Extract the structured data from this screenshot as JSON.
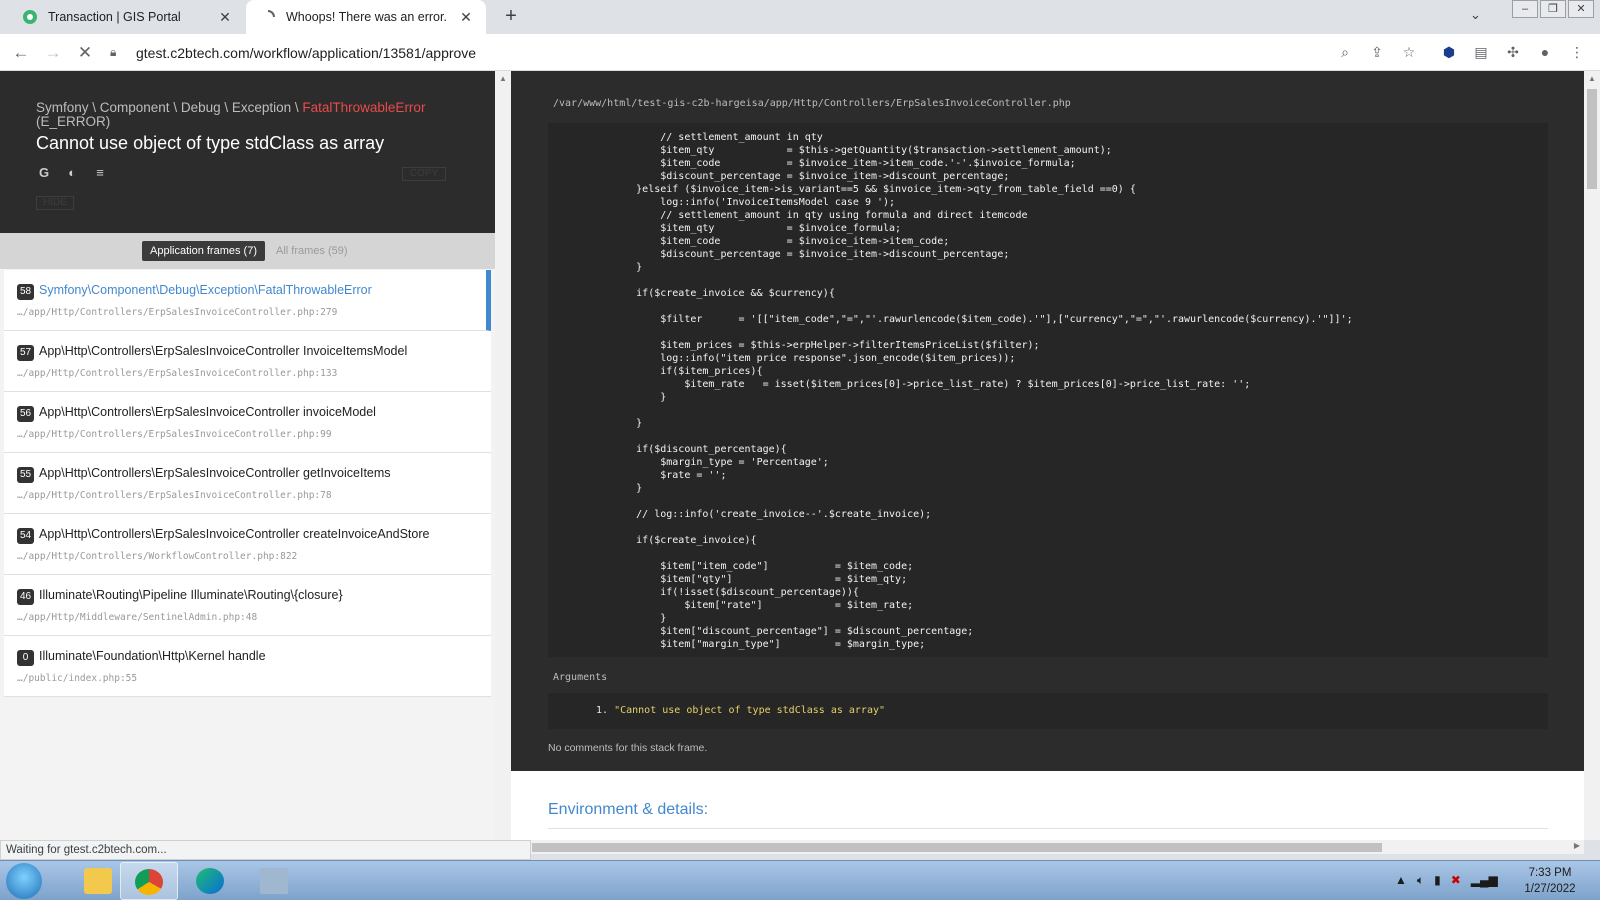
{
  "browser": {
    "tabs": [
      {
        "title": "Transaction | GIS Portal",
        "active": false
      },
      {
        "title": "Whoops! There was an error.",
        "active": true
      }
    ],
    "new_tab": "+",
    "url": "gtest.c2btech.com/workflow/application/13581/approve",
    "status_text": "Waiting for gtest.c2btech.com..."
  },
  "exception": {
    "class_path": "Symfony \\ Component \\ Debug \\ Exception \\ ",
    "class_name": "FatalThrowableError",
    "level": "(E_ERROR)",
    "message": "Cannot use object of type stdClass as array",
    "copy_label": "COPY",
    "hide_label": "HIDE"
  },
  "frame_tabs": {
    "application": "Application frames (7)",
    "all": "All frames (59)"
  },
  "frames": [
    {
      "index": "58",
      "class": "Symfony\\Component\\Debug\\Exception\\FatalThrowableError",
      "path": "…/app/Http/Controllers/ErpSalesInvoiceController.php:279"
    },
    {
      "index": "57",
      "class": "App\\Http\\Controllers\\ErpSalesInvoiceController InvoiceItemsModel",
      "path": "…/app/Http/Controllers/ErpSalesInvoiceController.php:133"
    },
    {
      "index": "56",
      "class": "App\\Http\\Controllers\\ErpSalesInvoiceController invoiceModel",
      "path": "…/app/Http/Controllers/ErpSalesInvoiceController.php:99"
    },
    {
      "index": "55",
      "class": "App\\Http\\Controllers\\ErpSalesInvoiceController getInvoiceItems",
      "path": "…/app/Http/Controllers/ErpSalesInvoiceController.php:78"
    },
    {
      "index": "54",
      "class": "App\\Http\\Controllers\\ErpSalesInvoiceController createInvoiceAndStore",
      "path": "…/app/Http/Controllers/WorkflowController.php:822"
    },
    {
      "index": "46",
      "class": "Illuminate\\Routing\\Pipeline Illuminate\\Routing\\{closure}",
      "path": "…/app/Http/Middleware/SentinelAdmin.php:48"
    },
    {
      "index": "0",
      "class": "Illuminate\\Foundation\\Http\\Kernel handle",
      "path": "…/public/index.php:55"
    }
  ],
  "code_view": {
    "file_path": "/var/www/html/test-gis-c2b-hargeisa/app/Http/Controllers/ErpSalesInvoiceController.php",
    "lines": [
      "            // settlement_amount in qty",
      "            $item_qty            = $this->getQuantity($transaction->settlement_amount);",
      "            $item_code           = $invoice_item->item_code.'-'.$invoice_formula;",
      "            $discount_percentage = $invoice_item->discount_percentage;",
      "        }elseif ($invoice_item->is_variant==5 && $invoice_item->qty_from_table_field ==0) {",
      "            log::info('InvoiceItemsModel case 9 ');",
      "            // settlement_amount in qty using formula and direct itemcode",
      "            $item_qty            = $invoice_formula;",
      "            $item_code           = $invoice_item->item_code;",
      "            $discount_percentage = $invoice_item->discount_percentage;",
      "        }",
      "",
      "        if($create_invoice && $currency){",
      "",
      "            $filter      = '[[\"item_code\",\"=\",\"'.rawurlencode($item_code).'\"],[\"currency\",\"=\",\"'.rawurlencode($currency).'\"]]';",
      "",
      "            $item_prices = $this->erpHelper->filterItemsPriceList($filter);",
      "            log::info(\"item price response\".json_encode($item_prices));",
      "            if($item_prices){",
      "                $item_rate   = isset($item_prices[0]->price_list_rate) ? $item_prices[0]->price_list_rate: '';",
      "            }",
      "",
      "        }",
      "",
      "        if($discount_percentage){",
      "            $margin_type = 'Percentage';",
      "            $rate = '';",
      "        }",
      "",
      "        // log::info('create_invoice--'.$create_invoice);",
      "",
      "        if($create_invoice){",
      "",
      "            $item[\"item_code\"]           = $item_code;",
      "            $item[\"qty\"]                 = $item_qty;",
      "            if(!isset($discount_percentage)){",
      "                $item[\"rate\"]            = $item_rate;",
      "            }",
      "            $item[\"discount_percentage\"] = $discount_percentage;",
      "            $item[\"margin_type\"]         = $margin_type;"
    ],
    "arguments_label": "Arguments",
    "argument_index": "1.",
    "argument_value": "\"Cannot use object of type stdClass as array\"",
    "no_comments": "No comments for this stack frame.",
    "env_title": "Environment & details:"
  },
  "taskbar": {
    "time": "7:33 PM",
    "date": "1/27/2022"
  },
  "colors": {
    "error_red": "#ea4a4a",
    "link_blue": "#4288ce",
    "panel_dark": "#2c2c2c"
  }
}
